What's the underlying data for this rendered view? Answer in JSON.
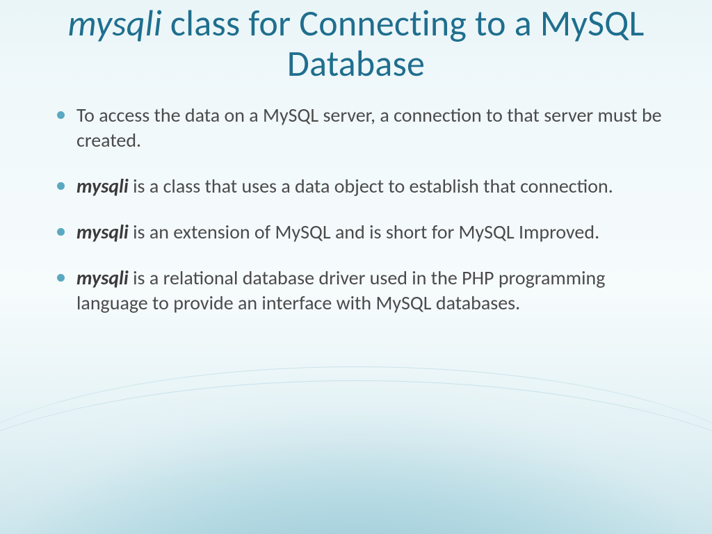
{
  "title": {
    "italic_prefix": "mysqli",
    "rest": " class for Connecting to a MySQL Database"
  },
  "bullets": [
    {
      "strong": "",
      "text": "To access the data on a MySQL server, a connection to that server must be created."
    },
    {
      "strong": "mysqli",
      "text": " is a class that uses a data object to establish that connection."
    },
    {
      "strong": "mysqli",
      "text": " is an extension of  MySQL  and is short for MySQL Improved."
    },
    {
      "strong": "mysqli",
      "text": " is a relational database driver used in the PHP programming language to provide an interface with MySQL databases."
    }
  ]
}
